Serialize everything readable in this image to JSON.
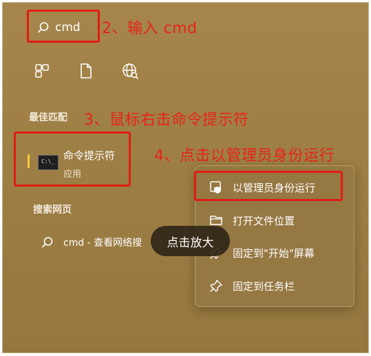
{
  "search": {
    "value": "cmd",
    "icon": "search-icon"
  },
  "annotations": {
    "step2": "2、输入 cmd",
    "step3": "3、鼠标右击命令提示符",
    "step4": "4、点击以管理员身份运行",
    "color": "#e31b14"
  },
  "quick_icons": [
    "apps-grid-icon",
    "document-icon",
    "globe-icon"
  ],
  "best_match": {
    "title": "最佳匹配",
    "app_name": "命令提示符",
    "app_type": "应用",
    "icon": "command-prompt-icon",
    "icon_text": "C:\\_"
  },
  "web_search": {
    "title": "搜索网页",
    "result_text": "cmd - 查看网络搜",
    "icon": "search-icon"
  },
  "context_menu": {
    "items": [
      {
        "label": "以管理员身份运行",
        "icon": "shield-icon"
      },
      {
        "label": "打开文件位置",
        "icon": "folder-icon"
      },
      {
        "label": "固定到\"开始\"屏幕",
        "icon": "pin-icon"
      },
      {
        "label": "固定到任务栏",
        "icon": "pin-icon"
      }
    ]
  },
  "tooltip": {
    "text": "点击放大"
  },
  "colors": {
    "background": "#a6864c",
    "accent_bar": "#ffc83d"
  }
}
